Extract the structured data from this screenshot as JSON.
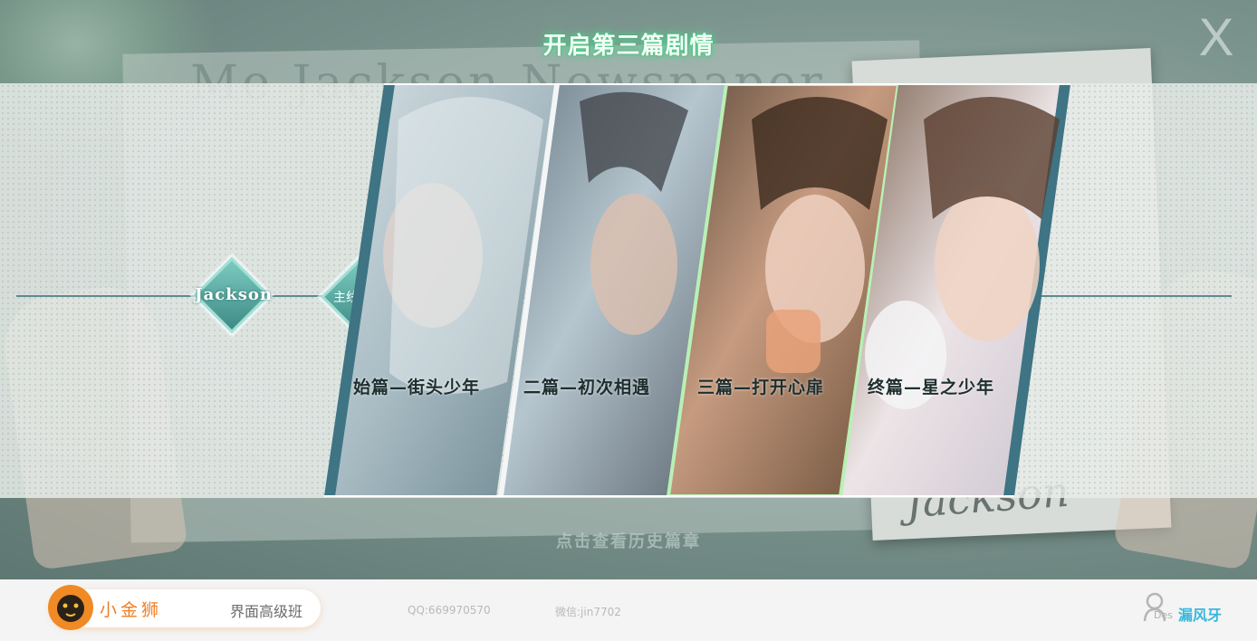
{
  "header": {
    "title": "开启第三篇剧情",
    "close_label": "X"
  },
  "background": {
    "headline_text": "Me Jackson Newspaper",
    "signature_text": "Jackson"
  },
  "route": {
    "character_node": "Jackson",
    "main_story_node": "主线篇章"
  },
  "chapters": [
    {
      "label": "始篇—街头少年",
      "selected": false
    },
    {
      "label": "二篇—初次相遇",
      "selected": false
    },
    {
      "label": "三篇—打开心扉",
      "selected": true
    },
    {
      "label": "终篇—星之少年",
      "selected": false
    }
  ],
  "history_link": "点击查看历史篇章",
  "footer": {
    "brand_name": "小金狮",
    "course_name": "界面高级班",
    "qq": "QQ:669970570",
    "wechat": "微信:jin7702",
    "user_sub_label": "Des",
    "author": "漏风牙"
  },
  "colors": {
    "accent_green": "#56d190",
    "node_teal": "#3d8a85",
    "brand_orange": "#f07e24",
    "author_blue": "#36b8dd"
  }
}
